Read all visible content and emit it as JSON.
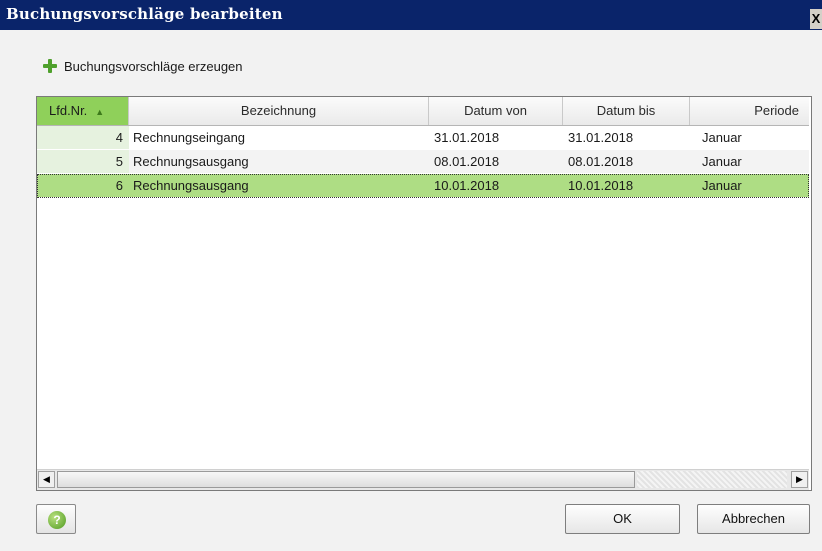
{
  "window": {
    "title": "Buchungsvorschläge bearbeiten",
    "close_glyph": "X"
  },
  "toolbar": {
    "generate_label": "Buchungsvorschläge erzeugen",
    "generate_icon": "plus-icon",
    "icon_color": "#4fa02c"
  },
  "table": {
    "columns": [
      "Lfd.Nr.",
      "Bezeichnung",
      "Datum von",
      "Datum bis",
      "Periode"
    ],
    "sorted_column": "Lfd.Nr.",
    "sort_direction": "ascending",
    "rows": [
      {
        "nr": "4",
        "bezeichnung": "Rechnungseingang",
        "datum_von": "31.01.2018",
        "datum_bis": "31.01.2018",
        "periode": "Januar"
      },
      {
        "nr": "5",
        "bezeichnung": "Rechnungsausgang",
        "datum_von": "08.01.2018",
        "datum_bis": "08.01.2018",
        "periode": "Januar"
      },
      {
        "nr": "6",
        "bezeichnung": "Rechnungsausgang",
        "datum_von": "10.01.2018",
        "datum_bis": "10.01.2018",
        "periode": "Januar"
      }
    ],
    "selected_row": "6",
    "selection_color": "#aedd84",
    "header_sorted_color": "#8fd05a"
  },
  "buttons": {
    "ok": "OK",
    "cancel": "Abbrechen",
    "help_icon": "help-icon"
  },
  "colors": {
    "titlebar": "#0a246a",
    "dialog_bg": "#f2f2f2"
  }
}
